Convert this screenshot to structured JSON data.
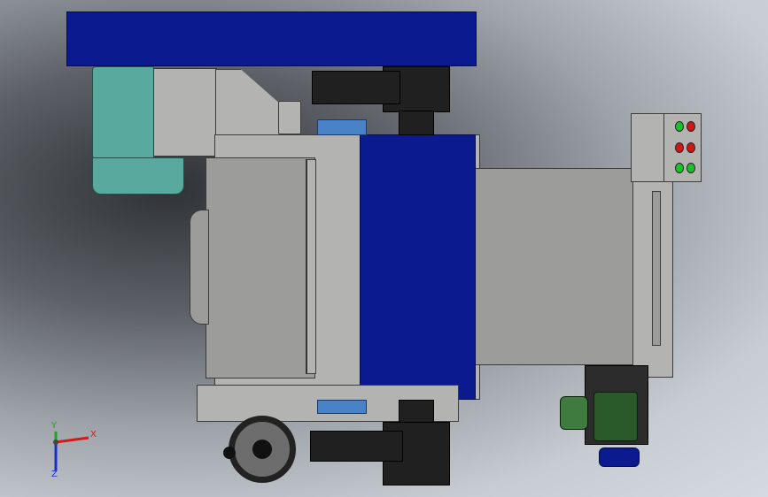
{
  "viewport": {
    "background": "#c6ccd2",
    "colors": {
      "housing_blue": "#0b1a8f",
      "plate_grey": "#9c9c9b",
      "motor_teal": "#5aa99e",
      "coupling_blue": "#4a82c8",
      "button_green": "#18c22a",
      "button_red": "#d21616"
    }
  },
  "triad": {
    "x_label": "X",
    "y_label": "Y",
    "z_label": "Z",
    "x_color": "#d21b1b",
    "y_color": "#1ea31e",
    "z_color": "#1b2ed2"
  },
  "control_box": {
    "buttons": [
      {
        "color": "green"
      },
      {
        "color": "red"
      },
      {
        "color": "red"
      },
      {
        "color": "red"
      },
      {
        "color": "green"
      },
      {
        "color": "green"
      }
    ]
  }
}
